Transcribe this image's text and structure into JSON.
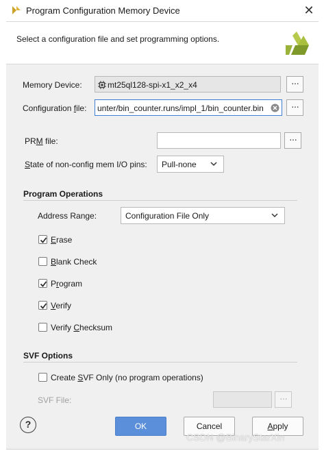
{
  "window": {
    "title": "Program Configuration Memory Device",
    "close_icon": "close-icon"
  },
  "header": {
    "text": "Select a configuration file and set programming options."
  },
  "fields": {
    "memory_device": {
      "label_pre": "Memory Device:",
      "value": "mt25ql128-spi-x1_x2_x4"
    },
    "config_file": {
      "label_pre": "Configuration ",
      "label_u": "f",
      "label_post": "ile:",
      "value": "unter/bin_counter.runs/impl_1/bin_counter.bin"
    },
    "prm_file": {
      "label_pre": "PR",
      "label_u": "M",
      "label_post": " file:",
      "value": ""
    },
    "state_pins": {
      "label_pre": "",
      "label_u": "S",
      "label_post": "tate of non-config mem I/O pins:",
      "value": "Pull-none"
    },
    "dots": "···"
  },
  "program_operations": {
    "title": "Program Operations",
    "address_range": {
      "label_pre": "Address Range:",
      "value": "Configuration File Only"
    },
    "checks": [
      {
        "pre": "",
        "u": "E",
        "post": "rase",
        "checked": true
      },
      {
        "pre": "",
        "u": "B",
        "post": "lank Check",
        "checked": false
      },
      {
        "pre": "P",
        "u": "r",
        "post": "ogram",
        "checked": true
      },
      {
        "pre": "",
        "u": "V",
        "post": "erify",
        "checked": true
      },
      {
        "pre": "Verify ",
        "u": "C",
        "post": "hecksum",
        "checked": false
      }
    ]
  },
  "svf_options": {
    "title": "SVF Options",
    "create_svf": {
      "pre": "Create ",
      "u": "S",
      "post": "VF Only (no program operations)",
      "checked": false
    },
    "svf_file_label": "SVF File:",
    "svf_file_value": ""
  },
  "buttons": {
    "help": "?",
    "ok": "OK",
    "cancel_pre": "Cancel",
    "apply_pre": "",
    "apply_u": "A",
    "apply_post": "pply"
  },
  "watermark": "CSDN @BinaryStarXin",
  "colors": {
    "accent": "#5b8fd9",
    "logo": "#9bb33a"
  }
}
